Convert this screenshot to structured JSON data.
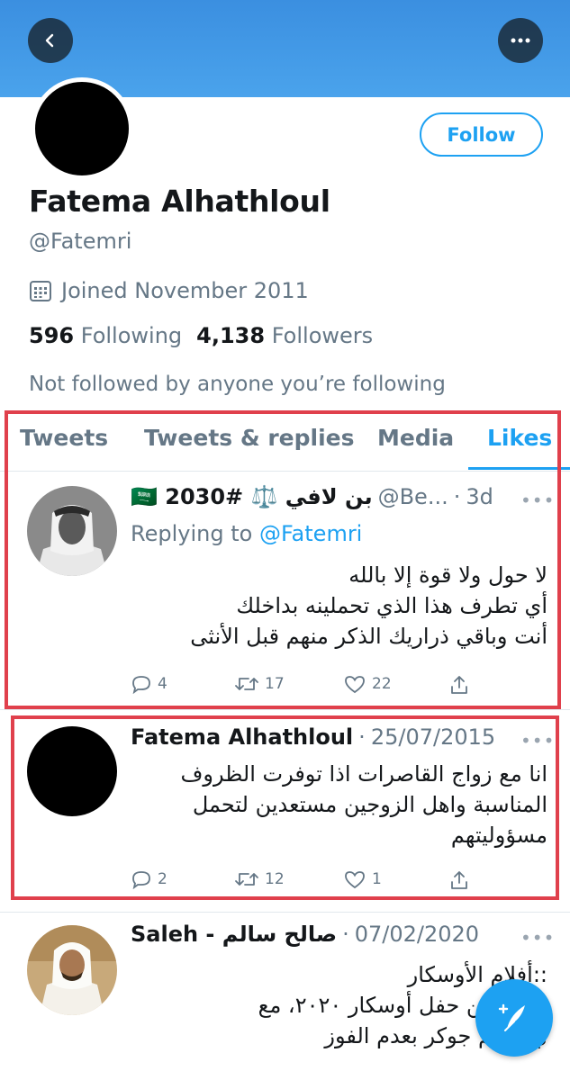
{
  "profile": {
    "display_name": "Fatema Alhathloul",
    "handle": "@Fatemri",
    "joined": "Joined November 2011",
    "following_count": "596",
    "following_label": "Following",
    "followers_count": "4,138",
    "followers_label": "Followers",
    "not_followed": "Not followed by anyone you’re following",
    "follow_label": "Follow"
  },
  "tabs": [
    "Tweets",
    "Tweets & replies",
    "Media",
    "Likes"
  ],
  "active_tab": "Likes",
  "tweets": [
    {
      "name": "🇸🇦 2030# ⚖️ بن لافي",
      "handle": "@Be...",
      "time": "3d",
      "replying_prefix": "Replying to",
      "replying_to": "@Fatemri",
      "body": "لا حول ولا قوة إلا بالله\nأي تطرف هذا الذي تحملينه بداخلك\nأنت وباقي ذراريك الذكر منهم قبل الأنثى",
      "replies": "4",
      "retweets": "17",
      "likes": "22"
    },
    {
      "name": "Fatema Alhathloul",
      "time": "25/07/2015",
      "body": "انا مع زواج القاصرات اذا توفرت الظروف المناسبة واهل الزوجين مستعدين لتحمل مسؤوليتهم",
      "replies": "2",
      "retweets": "12",
      "likes": "1"
    },
    {
      "name": "Saleh - صالح سالم",
      "time": "07/02/2020",
      "body": "::أفلام الأوسكار\nرمين عن حفل أوسكار ٢٠٢٠، مع\nي لفيلم جوكر بعدم الفوز"
    }
  ],
  "colors": {
    "accent": "#1da1f2",
    "highlight_box": "#e0404c",
    "banner": "#4aa3ec"
  },
  "icons": [
    "back-arrow-icon",
    "more-icon",
    "calendar-icon",
    "reply-icon",
    "retweet-icon",
    "like-icon",
    "share-icon",
    "compose-icon"
  ]
}
